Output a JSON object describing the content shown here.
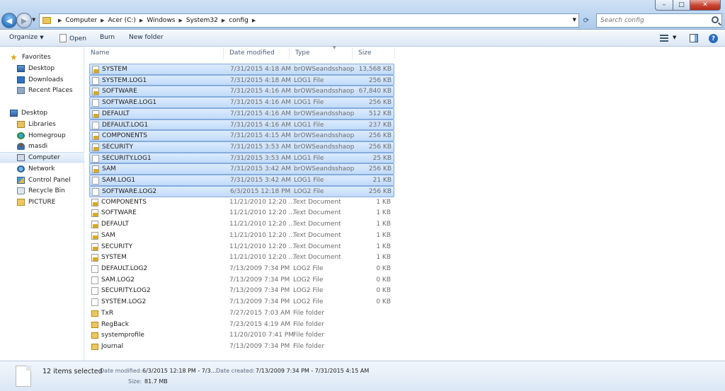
{
  "window": {
    "controls": {
      "minimize": "–",
      "maximize": "□",
      "close": "✕"
    }
  },
  "address": {
    "crumbs": [
      "Computer",
      "Acer (C:)",
      "Windows",
      "System32",
      "config"
    ]
  },
  "search": {
    "placeholder": "Search config"
  },
  "toolbar": {
    "organize": "Organize",
    "open": "Open",
    "burn": "Burn",
    "new_folder": "New folder",
    "help": "?"
  },
  "nav": {
    "favorites": "Favorites",
    "desktop_fav": "Desktop",
    "downloads": "Downloads",
    "recent_places": "Recent Places",
    "desktop": "Desktop",
    "libraries": "Libraries",
    "homegroup": "Homegroup",
    "user": "masdi",
    "computer": "Computer",
    "network": "Network",
    "control_panel": "Control Panel",
    "recycle_bin": "Recycle Bin",
    "picture": "PICTURE"
  },
  "columns": {
    "name": "Name",
    "date": "Date modified",
    "type": "Type",
    "size": "Size"
  },
  "files": [
    {
      "name": "SYSTEM",
      "date": "7/31/2015 4:18 AM",
      "type": "brOWSeandsshaop",
      "size": "13,568 KB",
      "icon": "lock",
      "selected": true
    },
    {
      "name": "SYSTEM.LOG1",
      "date": "7/31/2015 4:18 AM",
      "type": "LOG1 File",
      "size": "256 KB",
      "icon": "file",
      "selected": true
    },
    {
      "name": "SOFTWARE",
      "date": "7/31/2015 4:16 AM",
      "type": "brOWSeandsshaop",
      "size": "67,840 KB",
      "icon": "lock",
      "selected": true
    },
    {
      "name": "SOFTWARE.LOG1",
      "date": "7/31/2015 4:16 AM",
      "type": "LOG1 File",
      "size": "256 KB",
      "icon": "file",
      "selected": true
    },
    {
      "name": "DEFAULT",
      "date": "7/31/2015 4:16 AM",
      "type": "brOWSeandsshaop",
      "size": "512 KB",
      "icon": "lock",
      "selected": true
    },
    {
      "name": "DEFAULT.LOG1",
      "date": "7/31/2015 4:16 AM",
      "type": "LOG1 File",
      "size": "237 KB",
      "icon": "file",
      "selected": true
    },
    {
      "name": "COMPONENTS",
      "date": "7/31/2015 4:15 AM",
      "type": "brOWSeandsshaop",
      "size": "256 KB",
      "icon": "lock",
      "selected": true
    },
    {
      "name": "SECURITY",
      "date": "7/31/2015 3:53 AM",
      "type": "brOWSeandsshaop",
      "size": "256 KB",
      "icon": "lock",
      "selected": true
    },
    {
      "name": "SECURITY.LOG1",
      "date": "7/31/2015 3:53 AM",
      "type": "LOG1 File",
      "size": "25 KB",
      "icon": "file",
      "selected": true
    },
    {
      "name": "SAM",
      "date": "7/31/2015 3:42 AM",
      "type": "brOWSeandsshaop",
      "size": "256 KB",
      "icon": "lock",
      "selected": true
    },
    {
      "name": "SAM.LOG1",
      "date": "7/31/2015 3:42 AM",
      "type": "LOG1 File",
      "size": "21 KB",
      "icon": "file",
      "selected": true
    },
    {
      "name": "SOFTWARE.LOG2",
      "date": "6/3/2015 12:18 PM",
      "type": "LOG2 File",
      "size": "256 KB",
      "icon": "file",
      "selected": true
    },
    {
      "name": "COMPONENTS",
      "date": "11/21/2010 12:20 ...",
      "type": "Text Document",
      "size": "1 KB",
      "icon": "lock",
      "selected": false
    },
    {
      "name": "SOFTWARE",
      "date": "11/21/2010 12:20 ...",
      "type": "Text Document",
      "size": "1 KB",
      "icon": "lock",
      "selected": false
    },
    {
      "name": "DEFAULT",
      "date": "11/21/2010 12:20 ...",
      "type": "Text Document",
      "size": "1 KB",
      "icon": "lock",
      "selected": false
    },
    {
      "name": "SAM",
      "date": "11/21/2010 12:20 ...",
      "type": "Text Document",
      "size": "1 KB",
      "icon": "lock",
      "selected": false
    },
    {
      "name": "SECURITY",
      "date": "11/21/2010 12:20 ...",
      "type": "Text Document",
      "size": "1 KB",
      "icon": "lock",
      "selected": false
    },
    {
      "name": "SYSTEM",
      "date": "11/21/2010 12:20 ...",
      "type": "Text Document",
      "size": "1 KB",
      "icon": "lock",
      "selected": false
    },
    {
      "name": "DEFAULT.LOG2",
      "date": "7/13/2009 7:34 PM",
      "type": "LOG2 File",
      "size": "0 KB",
      "icon": "file",
      "selected": false
    },
    {
      "name": "SAM.LOG2",
      "date": "7/13/2009 7:34 PM",
      "type": "LOG2 File",
      "size": "0 KB",
      "icon": "file",
      "selected": false
    },
    {
      "name": "SECURITY.LOG2",
      "date": "7/13/2009 7:34 PM",
      "type": "LOG2 File",
      "size": "0 KB",
      "icon": "file",
      "selected": false
    },
    {
      "name": "SYSTEM.LOG2",
      "date": "7/13/2009 7:34 PM",
      "type": "LOG2 File",
      "size": "0 KB",
      "icon": "file",
      "selected": false
    },
    {
      "name": "TxR",
      "date": "7/27/2015 7:03 AM",
      "type": "File folder",
      "size": "",
      "icon": "folder",
      "selected": false
    },
    {
      "name": "RegBack",
      "date": "7/23/2015 4:19 AM",
      "type": "File folder",
      "size": "",
      "icon": "folder",
      "selected": false
    },
    {
      "name": "systemprofile",
      "date": "11/20/2010 7:41 PM",
      "type": "File folder",
      "size": "",
      "icon": "folder",
      "selected": false
    },
    {
      "name": "Journal",
      "date": "7/13/2009 7:34 PM",
      "type": "File folder",
      "size": "",
      "icon": "folder",
      "selected": false
    }
  ],
  "details": {
    "count": "12 items selected",
    "modified_label": "Date modified:",
    "modified_value": "6/3/2015 12:18 PM - 7/3...",
    "created_label": "Date created:",
    "created_value": "7/13/2009 7:34 PM - 7/31/2015 4:15 AM",
    "size_label": "Size:",
    "size_value": "81.7 MB"
  },
  "colors": {
    "selection_fill": "#c9e0fb",
    "selection_border": "#84acdd",
    "chrome_blue": "#bcd5f0"
  }
}
